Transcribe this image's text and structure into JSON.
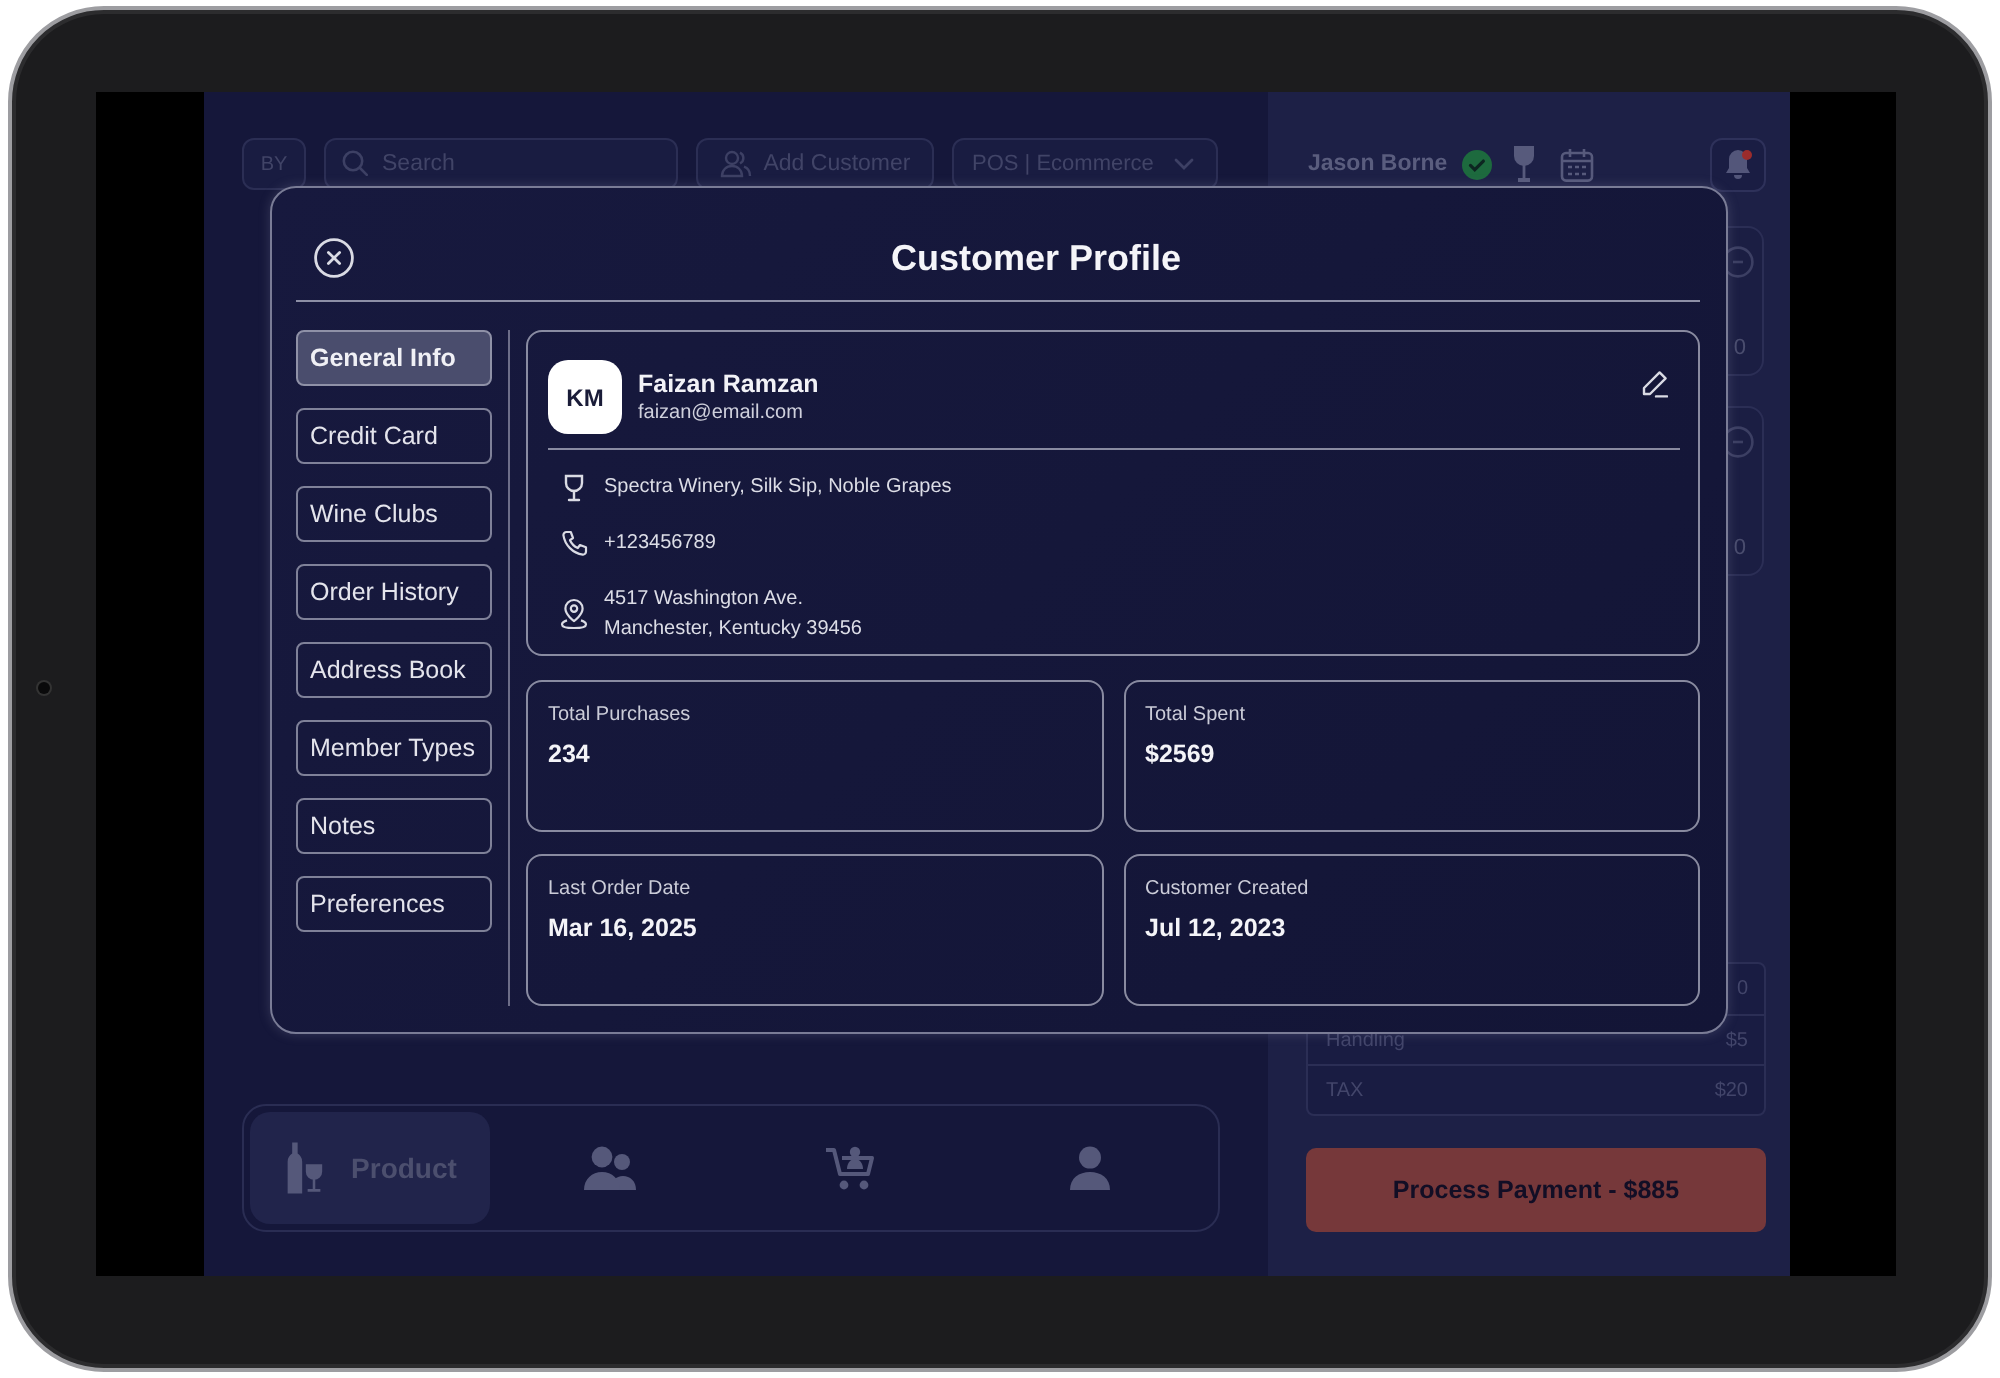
{
  "top_bar": {
    "badge": "BY",
    "search": {
      "placeholder": "Search"
    },
    "add_button": "Add Customer",
    "channel_select": "POS | Ecommerce"
  },
  "side_panel": {
    "user_name": "Jason Borne",
    "verified": true,
    "notification": true,
    "cards": [
      {
        "value": "0"
      },
      {
        "value": "0"
      }
    ],
    "summary": [
      {
        "value": "0"
      },
      {
        "label": "Handling",
        "value": "$5"
      },
      {
        "label": "TAX",
        "value": "$20"
      }
    ],
    "pay_button": "Process Payment - $885"
  },
  "modal": {
    "title": "Customer Profile",
    "tabs": [
      {
        "label": "General Info",
        "selected": true
      },
      {
        "label": "Credit Card",
        "selected": false
      },
      {
        "label": "Wine Clubs",
        "selected": false
      },
      {
        "label": "Order History",
        "selected": false
      },
      {
        "label": "Address Book",
        "selected": false
      },
      {
        "label": "Member Types",
        "selected": false
      },
      {
        "label": "Notes",
        "selected": false
      },
      {
        "label": "Preferences",
        "selected": false
      }
    ],
    "customer": {
      "initials": "KM",
      "name": "Faizan Ramzan",
      "email": "faizan@email.com",
      "details": [
        {
          "kind": "wineries",
          "text": "Spectra Winery, Silk Sip, Noble Grapes"
        },
        {
          "kind": "phone",
          "text": "+123456789"
        },
        {
          "kind": "address",
          "text": "4517 Washington Ave.\nManchester, Kentucky 39456"
        }
      ]
    },
    "stats": [
      {
        "label": "Total Purchases",
        "value": "234"
      },
      {
        "label": "Total Spent",
        "value": "$2569"
      },
      {
        "label": "Last Order Date",
        "value": "Mar 16, 2025"
      },
      {
        "label": "Customer Created",
        "value": "Jul 12, 2023"
      }
    ]
  },
  "bottom_nav": [
    {
      "kind": "product",
      "label": "Product",
      "selected": true
    },
    {
      "kind": "customers",
      "selected": false
    },
    {
      "kind": "cart",
      "selected": false
    },
    {
      "kind": "account",
      "selected": false
    }
  ]
}
